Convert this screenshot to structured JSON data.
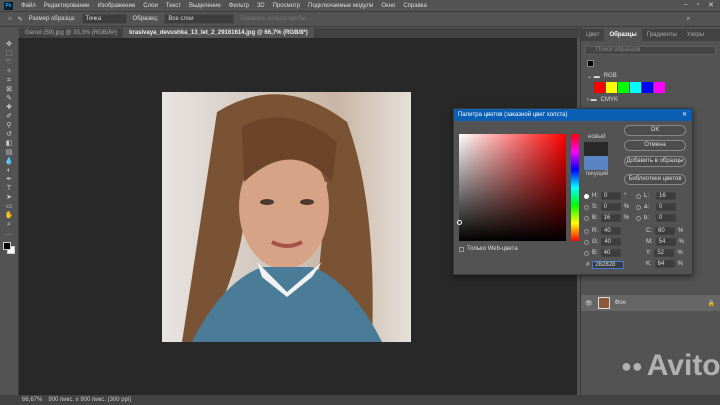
{
  "menu": [
    "Файл",
    "Редактирование",
    "Изображение",
    "Слои",
    "Текст",
    "Выделение",
    "Фильтр",
    "3D",
    "Просмотр",
    "Подключаемые модули",
    "Окно",
    "Справка"
  ],
  "app_icon": "Ps",
  "options": {
    "sample_size_label": "Размер образца:",
    "sample_size_value": "Точка",
    "sample_label": "Образец:",
    "sample_value": "Все слои",
    "show_ring": "Показать кольцо пробы"
  },
  "tabs": [
    {
      "label": "Gerod (59).jpg @ 33,3% (RGB/8#)"
    },
    {
      "label": "krasivaya_devushka_13_let_2_29161614.jpg @ 66,7% (RGB/8*)"
    }
  ],
  "status": {
    "zoom": "66,67%",
    "doc": "900 пикс. x 900 пикс. (300 ppi)"
  },
  "panel": {
    "tabs": [
      "Цвет",
      "Образцы",
      "Градиенты",
      "Узоры"
    ],
    "search_placeholder": "Поиск образцов",
    "groups": [
      "RGB",
      "CMYK"
    ],
    "rgb_swatches": [
      "#ff0000",
      "#ffff00",
      "#00ff00",
      "#00ffff",
      "#0000ff",
      "#ff00ff"
    ],
    "layer_name": "Фон"
  },
  "dialog": {
    "title": "Палитра цветов (заказной цвет холста)",
    "new_label": "новый",
    "current_label": "текущий",
    "new_color": "#282828",
    "current_color": "#5b84c4",
    "ok": "OK",
    "cancel": "Отмена",
    "add_swatch": "Добавить в образцы",
    "libraries": "Библиотеки цветов",
    "web_only": "Только Web-цвета",
    "H": "0",
    "S": "0",
    "B": "16",
    "R": "40",
    "G": "40",
    "Bv": "40",
    "L": "16",
    "a": "0",
    "b": "0",
    "C": "60",
    "M": "54",
    "Y": "52",
    "K": "64",
    "hex": "282828",
    "deg": "°",
    "pct": "%"
  },
  "watermark": "Avito"
}
